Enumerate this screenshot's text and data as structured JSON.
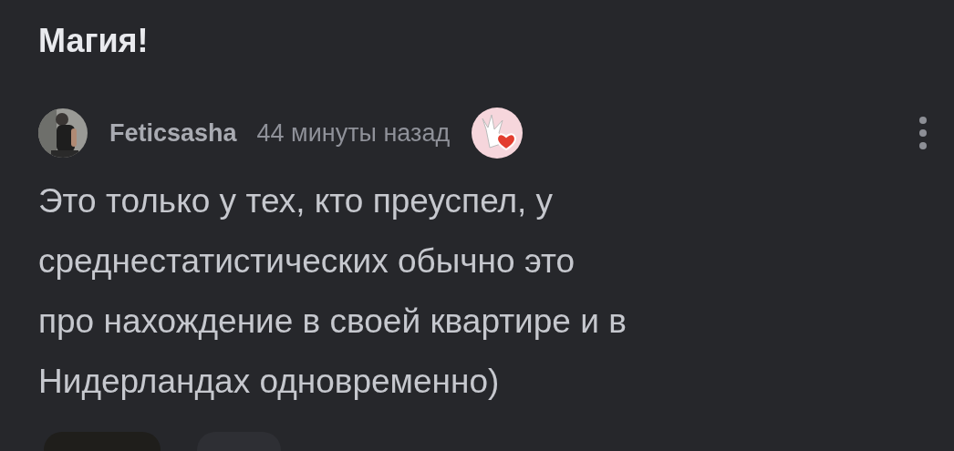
{
  "post": {
    "title": "Магия!"
  },
  "comment": {
    "author": "Feticsasha",
    "time": "44 минуты назад",
    "text_lines": [
      "Это только у тех, кто преуспел, у",
      "среднестатистических обычно это",
      "про нахождение в своей квартире и в",
      "Нидерландах одновременно)"
    ]
  }
}
